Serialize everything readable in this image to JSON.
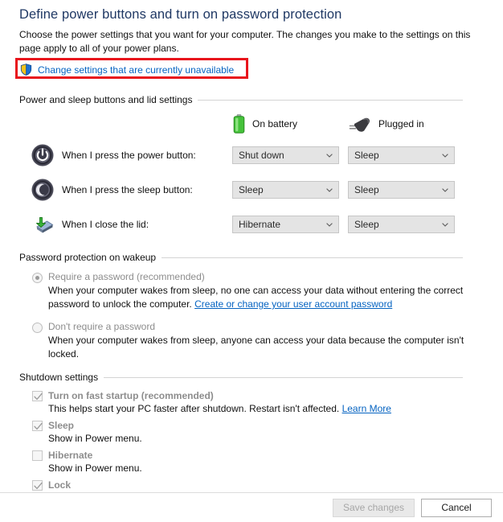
{
  "page": {
    "title": "Define power buttons and turn on password protection",
    "intro": "Choose the power settings that you want for your computer. The changes you make to the settings on this page apply to all of your power plans."
  },
  "uac": {
    "link_label": "Change settings that are currently unavailable",
    "icon": "shield-icon",
    "highlight_color": "#e8141c",
    "link_color": "#0563c1"
  },
  "sections": {
    "power_buttons": {
      "heading": "Power and sleep buttons and lid settings",
      "columns": [
        {
          "label": "On battery",
          "icon": "battery-icon"
        },
        {
          "label": "Plugged in",
          "icon": "plug-icon"
        }
      ],
      "rows": [
        {
          "icon": "power-button-icon",
          "label": "When I press the power button:",
          "on_battery": "Shut down",
          "plugged_in": "Sleep"
        },
        {
          "icon": "sleep-button-icon",
          "label": "When I press the sleep button:",
          "on_battery": "Sleep",
          "plugged_in": "Sleep"
        },
        {
          "icon": "close-lid-icon",
          "label": "When I close the lid:",
          "on_battery": "Hibernate",
          "plugged_in": "Sleep"
        }
      ]
    },
    "password_protection": {
      "heading": "Password protection on wakeup",
      "options": [
        {
          "title": "Require a password (recommended)",
          "selected": true,
          "desc_before": "When your computer wakes from sleep, no one can access your data without entering the correct password to unlock the computer. ",
          "link": "Create or change your user account password",
          "desc_after": ""
        },
        {
          "title": "Don't require a password",
          "selected": false,
          "desc_before": "When your computer wakes from sleep, anyone can access your data because the computer isn't locked.",
          "link": "",
          "desc_after": ""
        }
      ]
    },
    "shutdown_settings": {
      "heading": "Shutdown settings",
      "items": [
        {
          "title": "Turn on fast startup (recommended)",
          "checked": true,
          "desc_before": "This helps start your PC faster after shutdown. Restart isn't affected. ",
          "link": "Learn More"
        },
        {
          "title": "Sleep",
          "checked": true,
          "desc_before": "Show in Power menu.",
          "link": ""
        },
        {
          "title": "Hibernate",
          "checked": false,
          "desc_before": "Show in Power menu.",
          "link": ""
        },
        {
          "title": "Lock",
          "checked": true,
          "desc_before": "",
          "link": ""
        }
      ]
    }
  },
  "footer": {
    "save_label": "Save changes",
    "save_disabled": true,
    "cancel_label": "Cancel"
  }
}
